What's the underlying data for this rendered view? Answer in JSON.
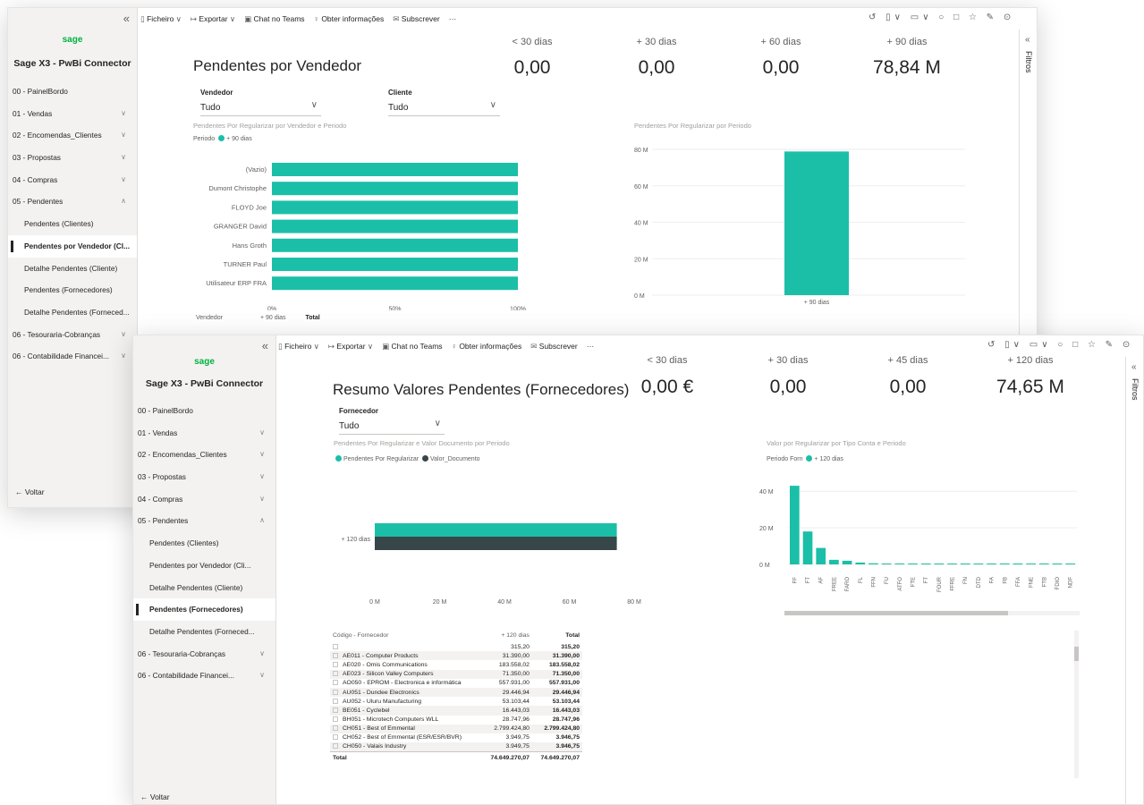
{
  "colors": {
    "teal": "#1bbfa8",
    "dark": "#374649",
    "accent": "#00b140"
  },
  "toolbar": {
    "file": "Ficheiro",
    "export": "Exportar",
    "teams": "Chat no Teams",
    "insights": "Obter informações",
    "subscribe": "Subscrever",
    "more": "···",
    "right_icons": "↺ ▯∨ ▭∨ ○ □  ☆ ✎ ⊙"
  },
  "app": {
    "logo": "sage",
    "title": "Sage X3 - PwBi Connector",
    "back": "Voltar"
  },
  "nav1": [
    {
      "label": "00 - PainelBordo",
      "sub": false,
      "chev": ""
    },
    {
      "label": "01 - Vendas",
      "sub": false,
      "chev": "∨"
    },
    {
      "label": "02 - Encomendas_Clientes",
      "sub": false,
      "chev": "∨"
    },
    {
      "label": "03 - Propostas",
      "sub": false,
      "chev": "∨"
    },
    {
      "label": "04 - Compras",
      "sub": false,
      "chev": "∨"
    },
    {
      "label": "05 - Pendentes",
      "sub": false,
      "chev": "∧"
    },
    {
      "label": "Pendentes (Clientes)",
      "sub": true,
      "chev": ""
    },
    {
      "label": "Pendentes por Vendedor (Cl...",
      "sub": true,
      "chev": "",
      "active": true
    },
    {
      "label": "Detalhe Pendentes (Cliente)",
      "sub": true,
      "chev": ""
    },
    {
      "label": "Pendentes (Fornecedores)",
      "sub": true,
      "chev": ""
    },
    {
      "label": "Detalhe Pendentes (Forneced...",
      "sub": true,
      "chev": ""
    },
    {
      "label": "06 - Tesouraria-Cobranças",
      "sub": false,
      "chev": "∨"
    },
    {
      "label": "06 - Contabilidade Financei...",
      "sub": false,
      "chev": "∨"
    }
  ],
  "nav2": [
    {
      "label": "00 - PainelBordo",
      "sub": false,
      "chev": ""
    },
    {
      "label": "01 - Vendas",
      "sub": false,
      "chev": "∨"
    },
    {
      "label": "02 - Encomendas_Clientes",
      "sub": false,
      "chev": "∨"
    },
    {
      "label": "03 - Propostas",
      "sub": false,
      "chev": "∨"
    },
    {
      "label": "04 - Compras",
      "sub": false,
      "chev": "∨"
    },
    {
      "label": "05 - Pendentes",
      "sub": false,
      "chev": "∧"
    },
    {
      "label": "Pendentes (Clientes)",
      "sub": true,
      "chev": ""
    },
    {
      "label": "Pendentes por Vendedor (Cli...",
      "sub": true,
      "chev": ""
    },
    {
      "label": "Detalhe Pendentes (Cliente)",
      "sub": true,
      "chev": ""
    },
    {
      "label": "Pendentes (Fornecedores)",
      "sub": true,
      "chev": "",
      "active": true
    },
    {
      "label": "Detalhe Pendentes (Forneced...",
      "sub": true,
      "chev": ""
    },
    {
      "label": "06 - Tesouraria-Cobranças",
      "sub": false,
      "chev": "∨"
    },
    {
      "label": "06 - Contabilidade Financei...",
      "sub": false,
      "chev": "∨"
    }
  ],
  "report1": {
    "title": "Pendentes por Vendedor",
    "kpis": [
      {
        "label": "< 30 dias",
        "value": "0,00"
      },
      {
        "label": "+ 30 dias",
        "value": "0,00"
      },
      {
        "label": "+ 60 dias",
        "value": "0,00"
      },
      {
        "label": "+ 90 dias",
        "value": "78,84 M"
      }
    ],
    "slicer_vendedor": {
      "label": "Vendedor",
      "value": "Tudo"
    },
    "slicer_cliente": {
      "label": "Cliente",
      "value": "Tudo"
    },
    "filters_label": "Filtros",
    "table_headers": [
      "Vendedor",
      "+ 90 dias",
      "Total"
    ]
  },
  "report2": {
    "title": "Resumo Valores Pendentes (Fornecedores)",
    "kpis": [
      {
        "label": "< 30 dias",
        "value": "0,00 €"
      },
      {
        "label": "+ 30 dias",
        "value": "0,00"
      },
      {
        "label": "+ 45 dias",
        "value": "0,00"
      },
      {
        "label": "+ 120 dias",
        "value": "74,65 M"
      }
    ],
    "slicer_fornecedor": {
      "label": "Fornecedor",
      "value": "Tudo"
    },
    "table": {
      "headers": [
        "Código - Fornecedor",
        "+ 120 dias",
        "Total"
      ],
      "rows": [
        [
          "",
          "315,20",
          "315,20"
        ],
        [
          "AE011 - Computer Products",
          "31.390,00",
          "31.390,00"
        ],
        [
          "AE020 - Omis Communications",
          "183.558,02",
          "183.558,02"
        ],
        [
          "AE023 - Silicon Valley Computers",
          "71.350,00",
          "71.350,00"
        ],
        [
          "AO050 - EPROM - Electronica e informática",
          "557.931,00",
          "557.931,00"
        ],
        [
          "AU051 - Dundee Electronics",
          "29.446,94",
          "29.446,94"
        ],
        [
          "AU052 - Uluru Manufacturing",
          "53.103,44",
          "53.103,44"
        ],
        [
          "BE051 - Cyclebel",
          "16.443,03",
          "16.443,03"
        ],
        [
          "BH051 - Microtech Computers WLL",
          "28.747,96",
          "28.747,96"
        ],
        [
          "CH051 - Best of Emmental",
          "2.799.424,80",
          "2.799.424,80"
        ],
        [
          "CH052 - Best of Emmental (ESR/ESR/BVR)",
          "3.949,75",
          "3.946,75"
        ],
        [
          "CH050 - Valais Industry",
          "3.949,75",
          "3.946,75"
        ]
      ],
      "total": [
        "Total",
        "74.649.270,07",
        "74.649.270,07"
      ]
    }
  },
  "chart_data": [
    {
      "type": "bar",
      "orientation": "horizontal",
      "title": "Pendentes Por Regularizar por Vendedor e Periodo",
      "legend_title": "Periodo",
      "categories": [
        "(Vazio)",
        "Dumont Christophe",
        "FLOYD Joe",
        "GRANGER David",
        "Hans Groth",
        "TURNER Paul",
        "Utilisateur ERP FRA"
      ],
      "series": [
        {
          "name": "+ 90 dias",
          "values": [
            100,
            100,
            100,
            100,
            100,
            100,
            100
          ]
        }
      ],
      "xticks": [
        "0%",
        "50%",
        "100%"
      ],
      "xlim": [
        0,
        100
      ]
    },
    {
      "type": "bar",
      "title": "Pendentes Por Regularizar por Periodo",
      "categories": [
        "+ 90 dias"
      ],
      "values": [
        78.84
      ],
      "yticks": [
        "0 M",
        "20 M",
        "40 M",
        "60 M",
        "80 M"
      ],
      "ylim": [
        0,
        80
      ]
    },
    {
      "type": "bar",
      "orientation": "horizontal",
      "title": "Pendentes Por Regularizar e Valor Documento por Periodo",
      "categories": [
        "+ 120 dias"
      ],
      "series": [
        {
          "name": "Pendentes Por Regularizar",
          "values": [
            74.65
          ]
        },
        {
          "name": "Valor_Documento",
          "values": [
            74.65
          ]
        }
      ],
      "xticks": [
        "0 M",
        "20 M",
        "40 M",
        "60 M",
        "80 M"
      ],
      "xlim": [
        0,
        80
      ]
    },
    {
      "type": "bar",
      "title": "Valor por Regularizar por Tipo Conta e Periodo",
      "legend_title": "Periodo Forn",
      "categories": [
        "FF",
        "FT",
        "AF",
        "FREE",
        "FARO",
        "FL",
        "FFN",
        "FU",
        "ATFO",
        "FTE",
        "FT",
        "FOUR",
        "FFRE",
        "FN",
        "DTD",
        "FA",
        "FB",
        "FFA",
        "FNE",
        "FTB",
        "FDIO",
        "NDF"
      ],
      "series": [
        {
          "name": "+ 120 dias",
          "values": [
            43,
            18,
            9,
            2.5,
            2,
            1,
            0.6,
            0.4,
            0.3,
            0.3,
            0.2,
            0.2,
            0.2,
            0.2,
            0.2,
            0.2,
            0.2,
            0.2,
            0.2,
            0.2,
            0.2,
            0.2
          ]
        }
      ],
      "yticks": [
        "0 M",
        "20 M",
        "40 M"
      ],
      "ylim": [
        0,
        45
      ]
    }
  ]
}
